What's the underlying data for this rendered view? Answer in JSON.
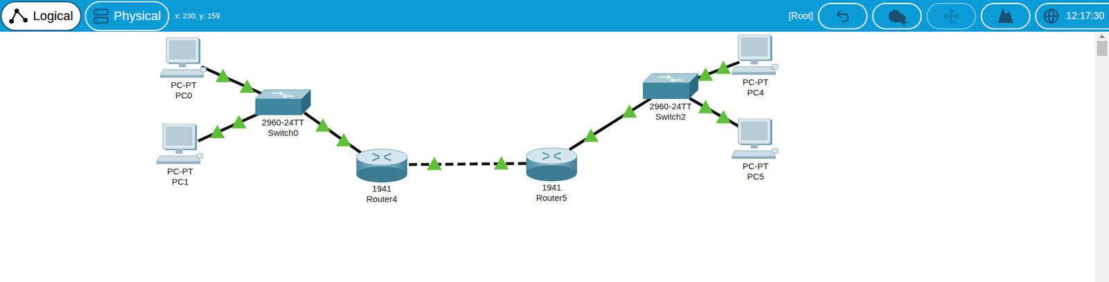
{
  "toolbar": {
    "tabs": [
      {
        "label": "Logical",
        "selected": true
      },
      {
        "label": "Physical",
        "selected": false
      }
    ],
    "coordinates": "x: 230, y: 159",
    "path": "[Root]",
    "buttons": [
      {
        "kind": "undo",
        "disabled": false
      },
      {
        "kind": "cloud",
        "disabled": false
      },
      {
        "kind": "move",
        "disabled": true
      },
      {
        "kind": "background",
        "disabled": false
      }
    ],
    "clock": "12:17:30"
  },
  "devices": [
    {
      "model": "PC-PT",
      "name": "PC0",
      "kind": "pc"
    },
    {
      "model": "PC-PT",
      "name": "PC1",
      "kind": "pc"
    },
    {
      "model": "2960-24TT",
      "name": "Switch0",
      "kind": "switch"
    },
    {
      "model": "1941",
      "name": "Router4",
      "kind": "router"
    },
    {
      "model": "1941",
      "name": "Router5",
      "kind": "router"
    },
    {
      "model": "2960-24TT",
      "name": "Switch2",
      "kind": "switch"
    },
    {
      "model": "PC-PT",
      "name": "PC4",
      "kind": "pc"
    },
    {
      "model": "PC-PT",
      "name": "PC5",
      "kind": "pc"
    }
  ],
  "links": [
    {
      "from": "PC0",
      "to": "Switch0",
      "kind": "straight",
      "up": true
    },
    {
      "from": "PC1",
      "to": "Switch0",
      "kind": "straight",
      "up": true
    },
    {
      "from": "Switch0",
      "to": "Router4",
      "kind": "straight",
      "up": true
    },
    {
      "from": "Router4",
      "to": "Router5",
      "kind": "crossover",
      "up": true
    },
    {
      "from": "Router5",
      "to": "Switch2",
      "kind": "straight",
      "up": true
    },
    {
      "from": "Switch2",
      "to": "PC4",
      "kind": "straight",
      "up": true
    },
    {
      "from": "Switch2",
      "to": "PC5",
      "kind": "straight",
      "up": true
    }
  ]
}
